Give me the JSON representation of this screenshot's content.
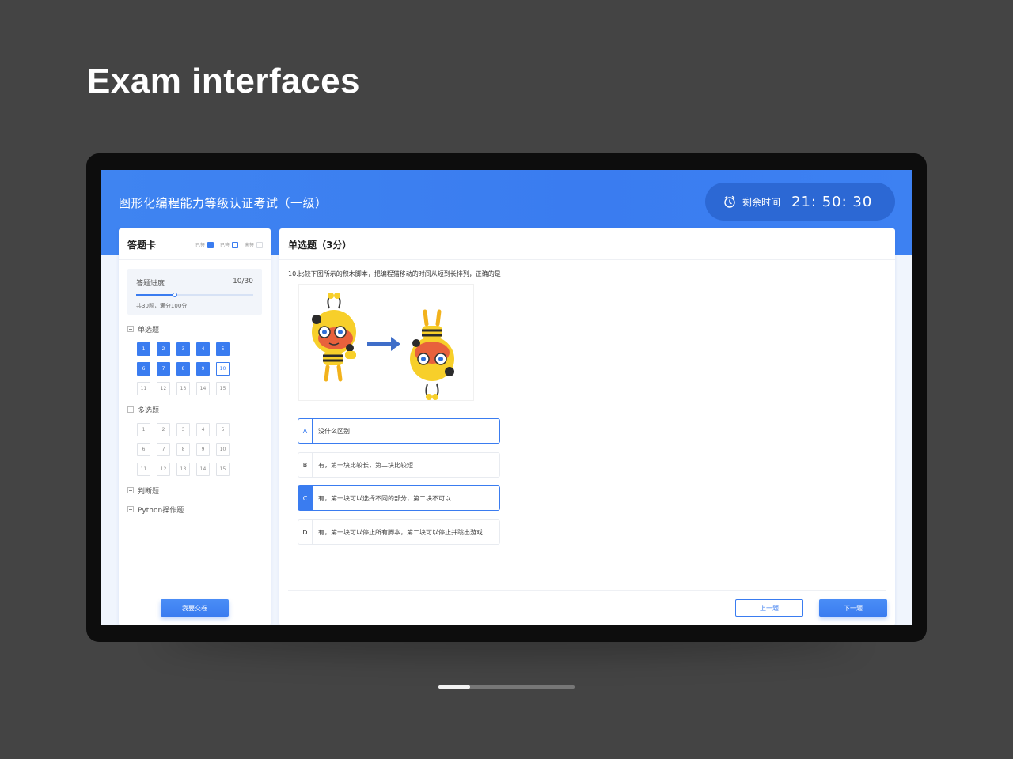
{
  "showcase": {
    "title": "Exam interfaces"
  },
  "header": {
    "exam_title": "图形化编程能力等级认证考试（一级）",
    "timer_label": "剩余时间",
    "timer_value": "21: 50: 30",
    "accent_color": "#3a7cf0"
  },
  "answer_card": {
    "title": "答题卡",
    "legend": [
      "已答",
      "已答",
      "未答"
    ],
    "progress": {
      "label": "答题进度",
      "count": "10/30",
      "answered": 10,
      "total": 30,
      "note": "共30题，满分100分"
    },
    "sections": [
      {
        "name": "单选题",
        "expanded": true,
        "items": [
          {
            "n": "1",
            "state": "done"
          },
          {
            "n": "2",
            "state": "done"
          },
          {
            "n": "3",
            "state": "done"
          },
          {
            "n": "4",
            "state": "done"
          },
          {
            "n": "5",
            "state": "done"
          },
          {
            "n": "6",
            "state": "done"
          },
          {
            "n": "7",
            "state": "done"
          },
          {
            "n": "8",
            "state": "done"
          },
          {
            "n": "9",
            "state": "done"
          },
          {
            "n": "10",
            "state": "current"
          },
          {
            "n": "11",
            "state": "none"
          },
          {
            "n": "12",
            "state": "none"
          },
          {
            "n": "13",
            "state": "none"
          },
          {
            "n": "14",
            "state": "none"
          },
          {
            "n": "15",
            "state": "none"
          }
        ]
      },
      {
        "name": "多选题",
        "expanded": true,
        "items": [
          {
            "n": "1",
            "state": "none"
          },
          {
            "n": "2",
            "state": "none"
          },
          {
            "n": "3",
            "state": "none"
          },
          {
            "n": "4",
            "state": "none"
          },
          {
            "n": "5",
            "state": "none"
          },
          {
            "n": "6",
            "state": "none"
          },
          {
            "n": "7",
            "state": "none"
          },
          {
            "n": "8",
            "state": "none"
          },
          {
            "n": "9",
            "state": "none"
          },
          {
            "n": "10",
            "state": "none"
          },
          {
            "n": "11",
            "state": "none"
          },
          {
            "n": "12",
            "state": "none"
          },
          {
            "n": "13",
            "state": "none"
          },
          {
            "n": "14",
            "state": "none"
          },
          {
            "n": "15",
            "state": "none"
          }
        ]
      },
      {
        "name": "判断题",
        "expanded": false,
        "items": []
      },
      {
        "name": "Python操作题",
        "expanded": false,
        "items": []
      }
    ],
    "submit_label": "我要交卷"
  },
  "main": {
    "section_title": "单选题（3分）",
    "question": "10.比较下图所示的积木脚本，把编程猫移动的时间从短到长排列，正确的是",
    "options": [
      {
        "letter": "A",
        "text": "没什么区别",
        "state": "hover"
      },
      {
        "letter": "B",
        "text": "有，第一块比较长，第二块比较短",
        "state": "normal"
      },
      {
        "letter": "C",
        "text": "有，第一块可以选择不同的部分，第二块不可以",
        "state": "checked"
      },
      {
        "letter": "D",
        "text": "有，第一块可以停止所有脚本，第二块可以停止并跳出游戏",
        "state": "normal"
      }
    ],
    "prev_label": "上一题",
    "next_label": "下一题"
  },
  "pager": {
    "current": 1,
    "total": 2
  }
}
